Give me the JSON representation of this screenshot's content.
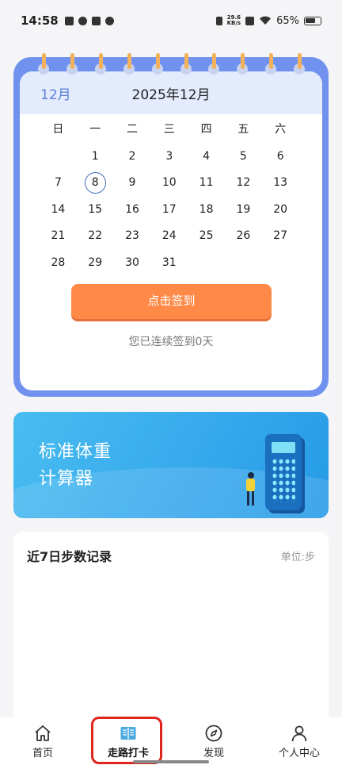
{
  "status_bar": {
    "time": "14:58",
    "net_speed_value": "29.6",
    "net_speed_unit": "KB/s",
    "battery": "65%"
  },
  "calendar": {
    "month_label": "12月",
    "title": "2025年12月",
    "weekdays": [
      "日",
      "一",
      "二",
      "三",
      "四",
      "五",
      "六"
    ],
    "weeks": [
      [
        "",
        "1",
        "2",
        "3",
        "4",
        "5",
        "6"
      ],
      [
        "7",
        "8",
        "9",
        "10",
        "11",
        "12",
        "13"
      ],
      [
        "14",
        "15",
        "16",
        "17",
        "18",
        "19",
        "20"
      ],
      [
        "21",
        "22",
        "23",
        "24",
        "25",
        "26",
        "27"
      ],
      [
        "28",
        "29",
        "30",
        "31",
        "",
        "",
        ""
      ]
    ],
    "today": "8",
    "checkin_button": "点击签到",
    "streak_text": "您已连续签到0天"
  },
  "bmi_banner": {
    "title_line1": "标准体重",
    "title_line2": "计算器"
  },
  "steps_card": {
    "title": "近7日步数记录",
    "unit": "单位:步"
  },
  "tabbar": {
    "items": [
      {
        "label": "首页",
        "icon": "home-icon"
      },
      {
        "label": "走路打卡",
        "icon": "book-icon",
        "active": true
      },
      {
        "label": "发现",
        "icon": "compass-icon"
      },
      {
        "label": "个人中心",
        "icon": "person-icon"
      }
    ]
  },
  "colors": {
    "accent_blue": "#7092ee",
    "checkin_orange": "#ff8a48",
    "highlight_red": "#e0241e"
  }
}
